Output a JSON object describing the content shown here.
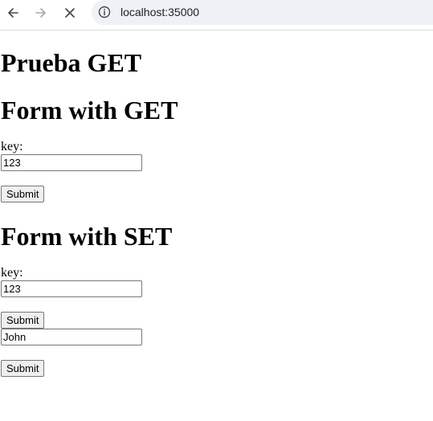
{
  "browser": {
    "url": "localhost:35000"
  },
  "page": {
    "title": "Prueba GET",
    "get_form": {
      "heading": "Form with GET",
      "key_label": "key:",
      "key_value": "123",
      "submit_label": "Submit"
    },
    "set_form": {
      "heading": "Form with SET",
      "key_label": "key:",
      "key_value": "123",
      "submit_label": "Submit",
      "value_value": "John",
      "submit2_label": "Submit"
    }
  }
}
